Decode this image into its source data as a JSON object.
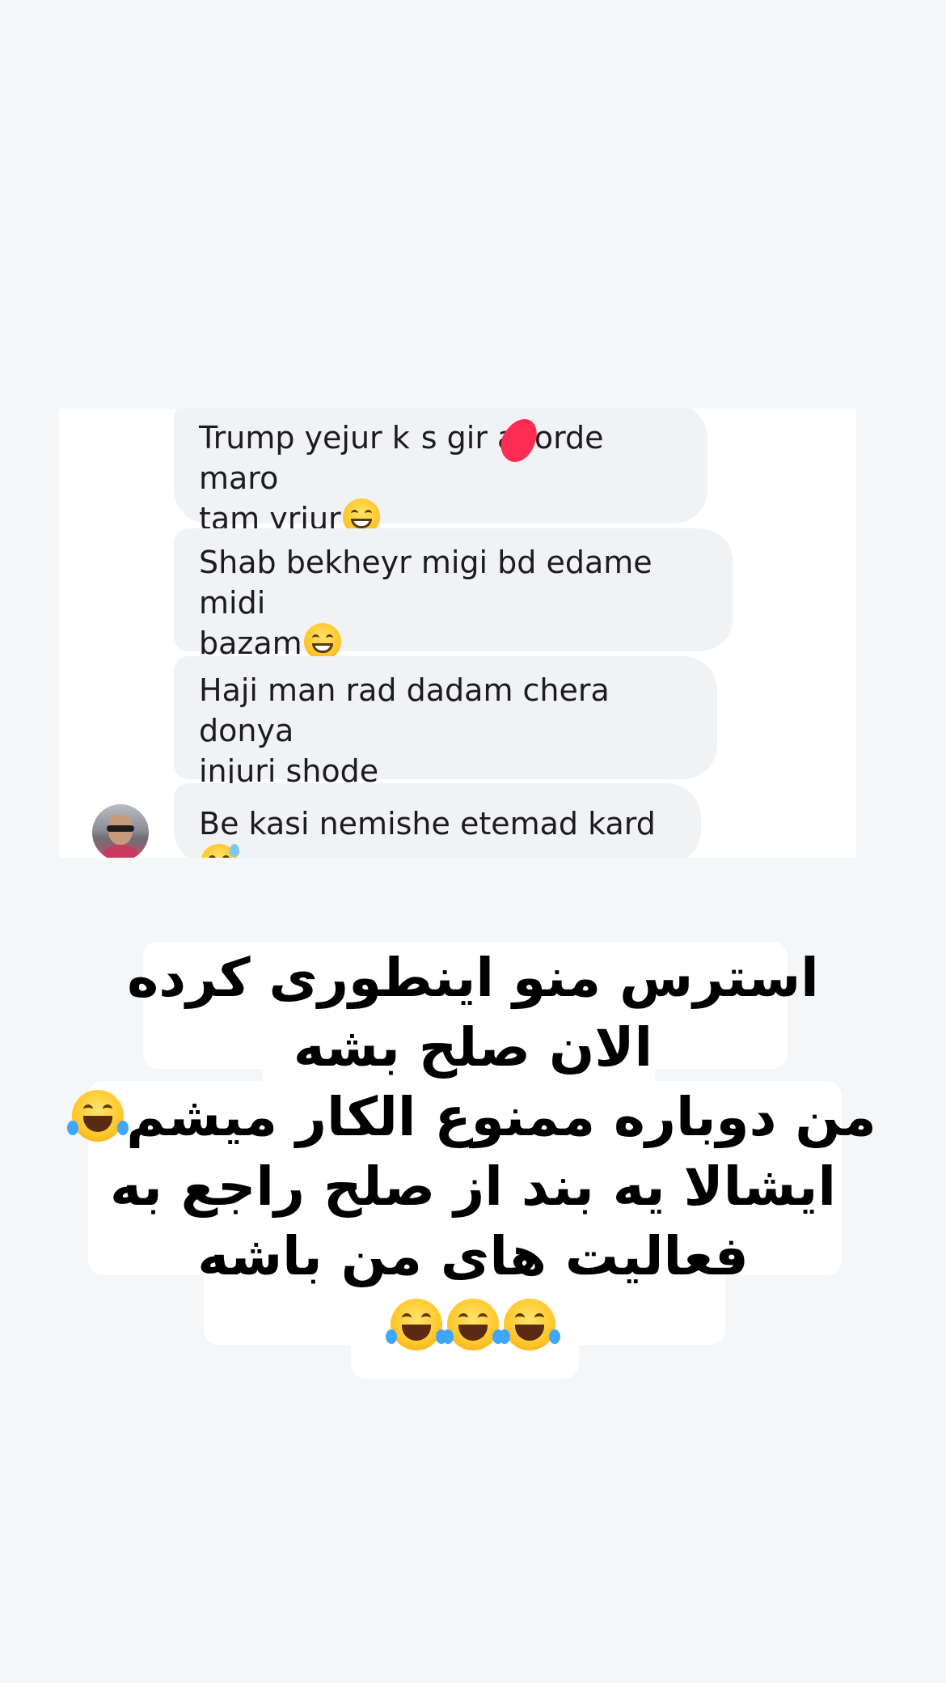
{
  "chat": {
    "messages": [
      {
        "text": "Trump yejur k•s gir avorde maro tam yrjur",
        "emoji": "grinning-face"
      },
      {
        "text": "Shab bekheyr migi bd edame midi bazam",
        "emoji": "grinning-face"
      },
      {
        "text": "Haji man rad dadam chera donya injuri shode",
        "emoji": ""
      },
      {
        "text": "Be kasi nemishe etemad kard",
        "emoji": "grinning-sweat-face"
      }
    ],
    "message_1_line1": "Trump yejur k",
    "message_1_line1b": "s gir avorde maro",
    "message_1_line2": "tam yrjur",
    "message_2_line1": "Shab bekheyr migi bd edame midi",
    "message_2_line2": "bazam",
    "message_3_line1": "Haji man rad dadam chera donya",
    "message_3_line2": "injuri shode",
    "message_4": "Be kasi nemishe etemad kard",
    "colors": {
      "bubble": "#f1f2f4",
      "panel": "#ffffff",
      "redaction": "#ff2d55"
    }
  },
  "caption": {
    "line1": "استرس منو اینطوری کرده",
    "line2": "الان صلح بشه",
    "line3": "من دوباره ممنوع الکار میشم",
    "line4": "ایشالا یه بند از صلح راجع به",
    "line5": "فعالیت های من باشه",
    "emoji": "face-with-tears-of-joy"
  }
}
